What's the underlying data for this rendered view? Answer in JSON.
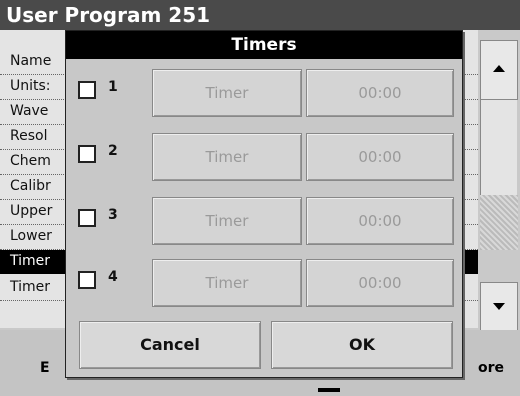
{
  "background": {
    "title": "User Program 251",
    "rows": [
      "Name",
      "Units:",
      "Wave",
      "Resol",
      "Chem",
      "Calibr",
      "Upper",
      "Lower",
      "Timer",
      "Timer"
    ],
    "bottom_left": "E",
    "bottom_right": "ore"
  },
  "dialog": {
    "title": "Timers",
    "timers": [
      {
        "number": "1",
        "name": "Timer",
        "time": "00:00"
      },
      {
        "number": "2",
        "name": "Timer",
        "time": "00:00"
      },
      {
        "number": "3",
        "name": "Timer",
        "time": "00:00"
      },
      {
        "number": "4",
        "name": "Timer",
        "time": "00:00"
      }
    ],
    "cancel_label": "Cancel",
    "ok_label": "OK"
  },
  "colors": {
    "titlebar": "#4a4a4a",
    "dialog_title_bg": "#000000",
    "disabled_text": "#9a9a9a"
  }
}
